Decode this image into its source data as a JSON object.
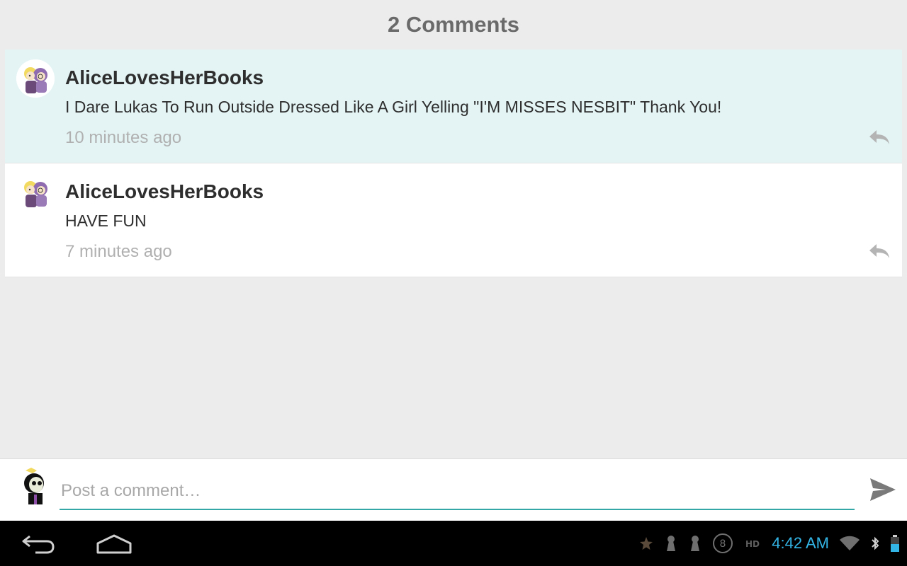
{
  "header": {
    "title": "2 Comments"
  },
  "comments": [
    {
      "author": "AliceLovesHerBooks",
      "text": "I Dare Lukas To Run Outside Dressed Like A Girl Yelling \"I'M MISSES NESBIT\" Thank You!",
      "time": "10 minutes ago",
      "avatar_icon": "cartoon-couple-avatar",
      "reply_icon": "reply-arrow-icon"
    },
    {
      "author": "AliceLovesHerBooks",
      "text": "HAVE FUN",
      "time": "7 minutes ago",
      "avatar_icon": "cartoon-couple-avatar",
      "reply_icon": "reply-arrow-icon"
    }
  ],
  "composer": {
    "placeholder": "Post a comment…",
    "value": "",
    "avatar_icon": "cartoon-skull-avatar",
    "send_icon": "send-arrow-icon"
  },
  "system_bar": {
    "time": "4:42 AM",
    "icons": [
      "back-icon",
      "home-icon",
      "star-notification-icon",
      "keyhole-icon",
      "keyhole-icon",
      "badge-8-icon",
      "hd-icon",
      "wifi-icon",
      "bluetooth-icon",
      "battery-icon"
    ]
  },
  "colors": {
    "background": "#ececec",
    "highlight_row": "#e4f4f5",
    "accent": "#33a6a6",
    "clock": "#33b5e5"
  }
}
